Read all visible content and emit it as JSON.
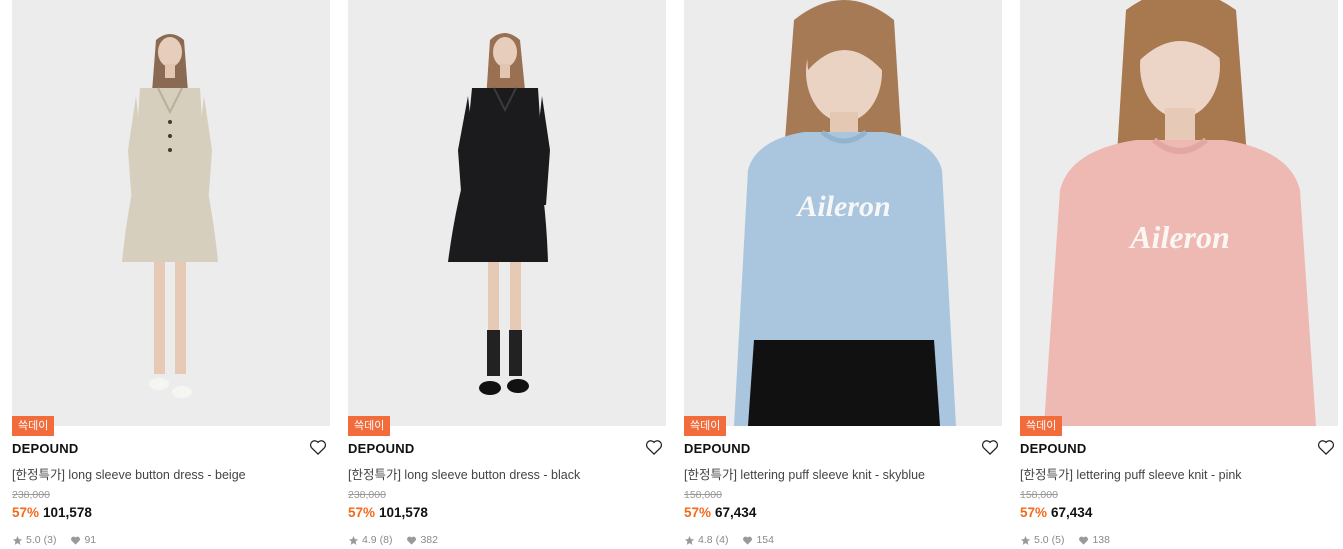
{
  "products": [
    {
      "badge": "쓱데이",
      "brand": "DEPOUND",
      "name": "[한정특가] long sleeve button dress - beige",
      "original_price": "238,000",
      "discount": "57%",
      "price": "101,578",
      "rating": "5.0",
      "review_count": "(3)",
      "likes": "91",
      "garment_color": "#d7cfbd",
      "image_type": "full-length-dress"
    },
    {
      "badge": "쓱데이",
      "brand": "DEPOUND",
      "name": "[한정특가] long sleeve button dress - black",
      "original_price": "238,000",
      "discount": "57%",
      "price": "101,578",
      "rating": "4.9",
      "review_count": "(8)",
      "likes": "382",
      "garment_color": "#1b1b1d",
      "image_type": "full-length-dress"
    },
    {
      "badge": "쓱데이",
      "brand": "DEPOUND",
      "name": "[한정특가] lettering puff sleeve knit - skyblue",
      "original_price": "158,000",
      "discount": "57%",
      "price": "67,434",
      "rating": "4.8",
      "review_count": "(4)",
      "likes": "154",
      "garment_color": "#a9c6de",
      "knit_lettering": "Aileron",
      "image_type": "close-up-knit"
    },
    {
      "badge": "쓱데이",
      "brand": "DEPOUND",
      "name": "[한정특가] lettering puff sleeve knit - pink",
      "original_price": "158,000",
      "discount": "57%",
      "price": "67,434",
      "rating": "5.0",
      "review_count": "(5)",
      "likes": "138",
      "garment_color": "#efb9b3",
      "knit_lettering": "Aileron",
      "image_type": "close-up-knit"
    }
  ],
  "colors": {
    "badge": "#f26b3a",
    "discount": "#f26b1d"
  }
}
